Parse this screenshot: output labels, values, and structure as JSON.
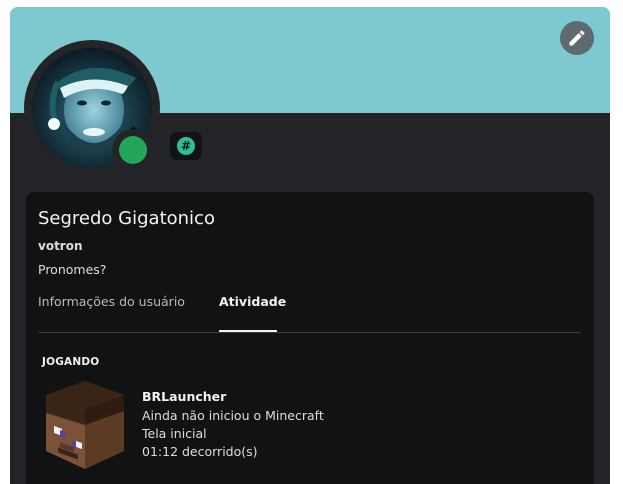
{
  "profile": {
    "display_name": "Segredo Gigatonico",
    "username": "votron",
    "pronouns": "Pronomes?",
    "status": "online",
    "banner_color": "#7ec8cf",
    "status_color": "#23a55a",
    "badge_icon": "hash-icon",
    "badge_glyph": "#"
  },
  "tabs": [
    {
      "label": "Informações do usuário",
      "active": false
    },
    {
      "label": "Atividade",
      "active": true
    }
  ],
  "activity": {
    "section_title": "JOGANDO",
    "game_name": "BRLauncher",
    "details": "Ainda não iniciou o Minecraft",
    "state": "Tela inicial",
    "elapsed": "01:12 decorrido(s)",
    "icon": "minecraft-steve-head-icon"
  },
  "edit_icon": "pencil-icon"
}
